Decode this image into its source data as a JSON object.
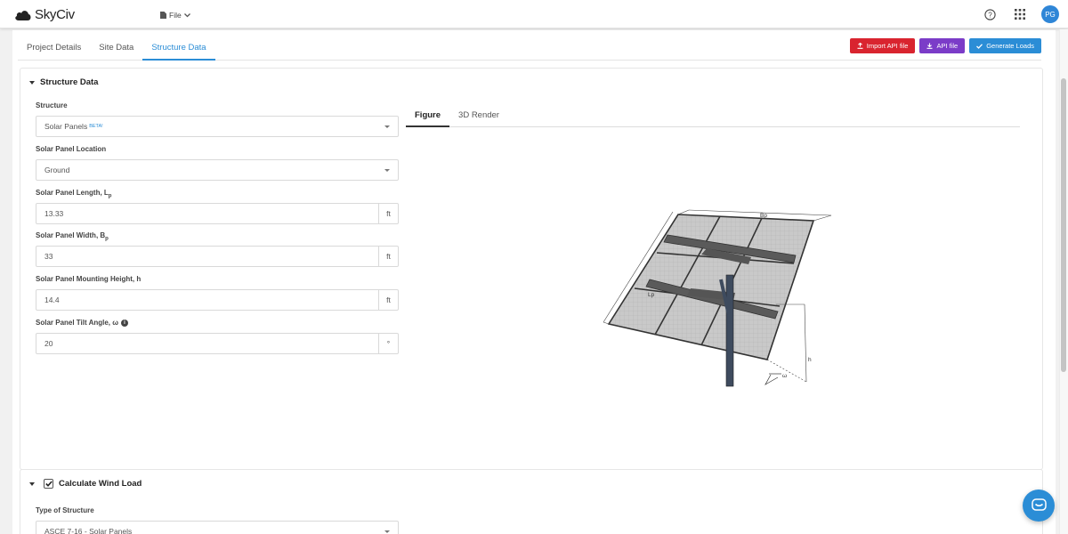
{
  "app": {
    "name": "SkyCiv",
    "file_menu": "File",
    "avatar_initials": "PG"
  },
  "tabs": [
    {
      "label": "Project Details"
    },
    {
      "label": "Site Data"
    },
    {
      "label": "Structure Data",
      "active": true
    }
  ],
  "actions": {
    "import_api": "Import API file",
    "api_file": "API file",
    "generate_loads": "Generate Loads"
  },
  "section1": {
    "title": "Structure Data",
    "fields": {
      "structure": {
        "label": "Structure",
        "value": "Solar Panels",
        "badge": "BETA!"
      },
      "location": {
        "label": "Solar Panel Location",
        "value": "Ground"
      },
      "length": {
        "label": "Solar Panel Length, L",
        "sub": "p",
        "value": "13.33",
        "unit": "ft"
      },
      "width": {
        "label": "Solar Panel Width, B",
        "sub": "p",
        "value": "33",
        "unit": "ft"
      },
      "height": {
        "label": "Solar Panel Mounting Height, h",
        "value": "14.4",
        "unit": "ft"
      },
      "tilt": {
        "label": "Solar Panel Tilt Angle, ω",
        "value": "20",
        "unit": "°"
      }
    },
    "figure_tabs": [
      {
        "label": "Figure",
        "active": true
      },
      {
        "label": "3D Render"
      }
    ],
    "figure_labels": {
      "bp": "Bp",
      "lp": "Lp",
      "h": "h",
      "omega": "ω"
    }
  },
  "section2": {
    "title": "Calculate Wind Load",
    "checked": true,
    "type_label": "Type of Structure",
    "type_value": "ASCE 7-16 - Solar Panels"
  },
  "colors": {
    "accent": "#2b8dd6",
    "import_btn": "#d9242f",
    "api_btn": "#7b3cc8"
  }
}
